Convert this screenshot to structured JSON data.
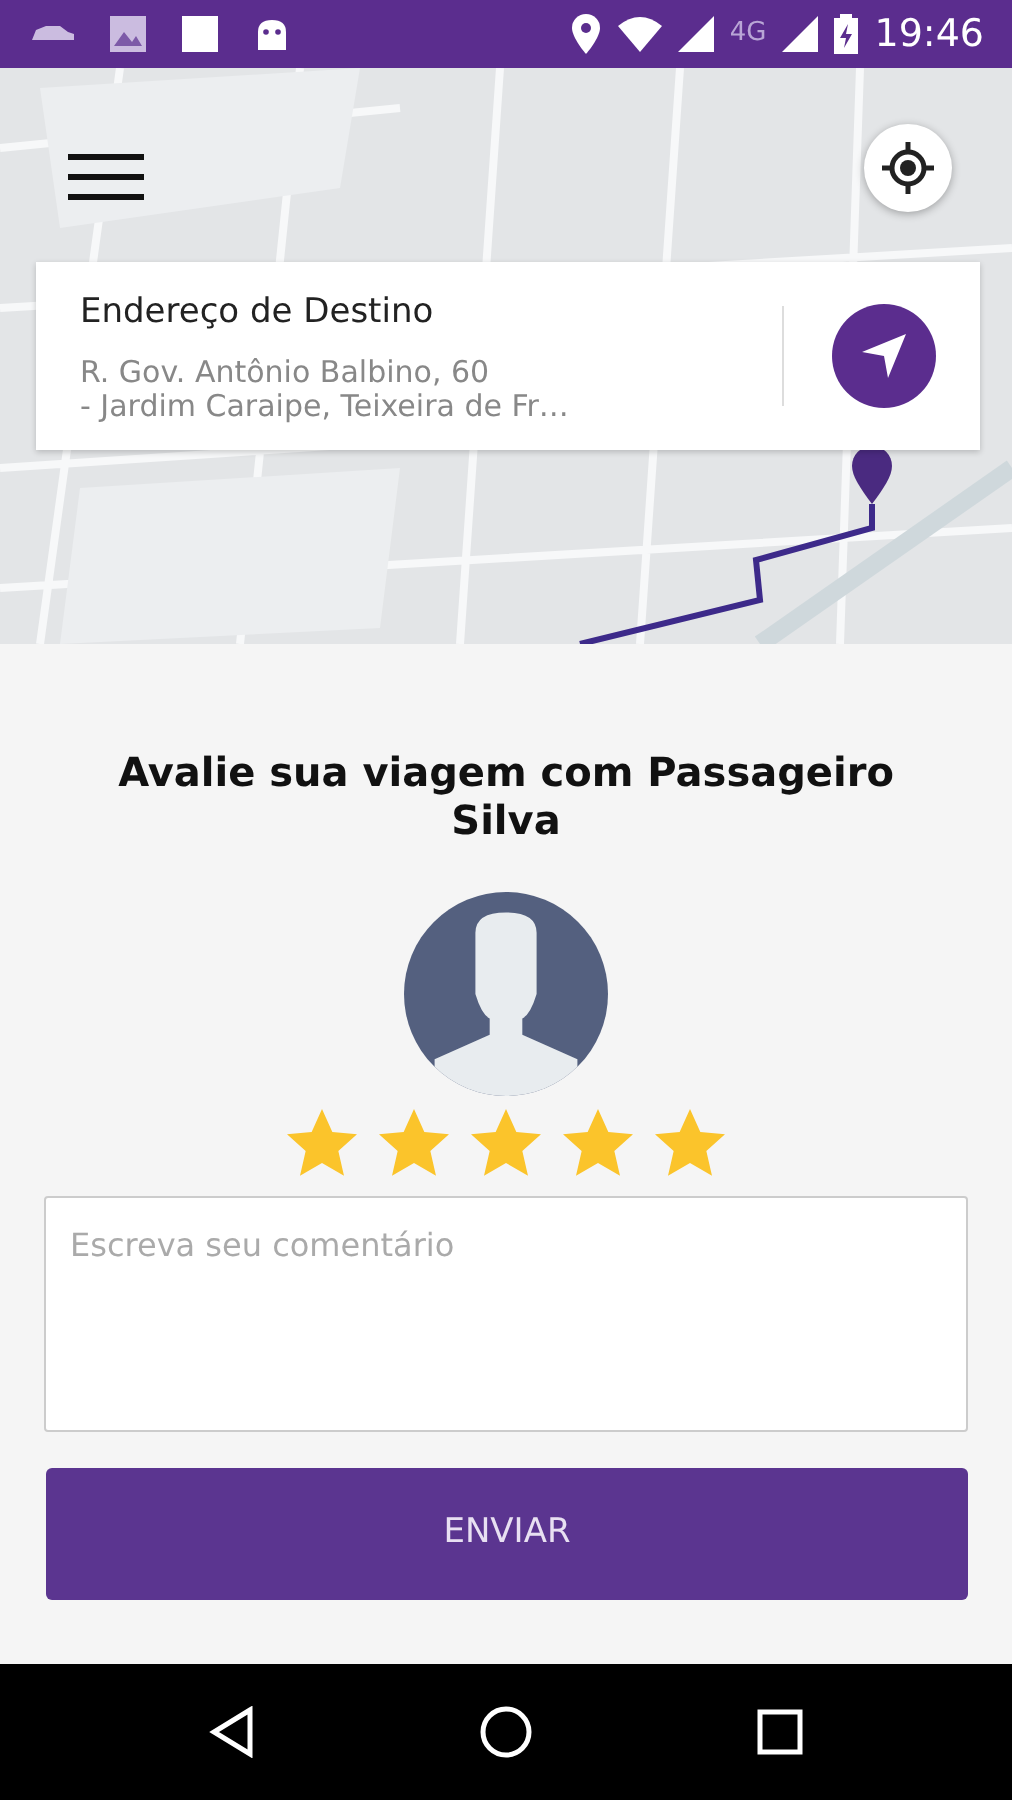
{
  "status_bar": {
    "network": "4G",
    "time": "19:46"
  },
  "destination": {
    "label": "Endereço de Destino",
    "address_lines": [
      "R. Gov. Antônio Balbino, 60",
      "- Jardim Caraipe, Teixeira de Fr…"
    ]
  },
  "rating": {
    "title": "Avalie sua viagem com Passageiro Silva",
    "stars": 5
  },
  "comment": {
    "placeholder": "Escreva seu comentário"
  },
  "submit_button": "ENVIAR"
}
